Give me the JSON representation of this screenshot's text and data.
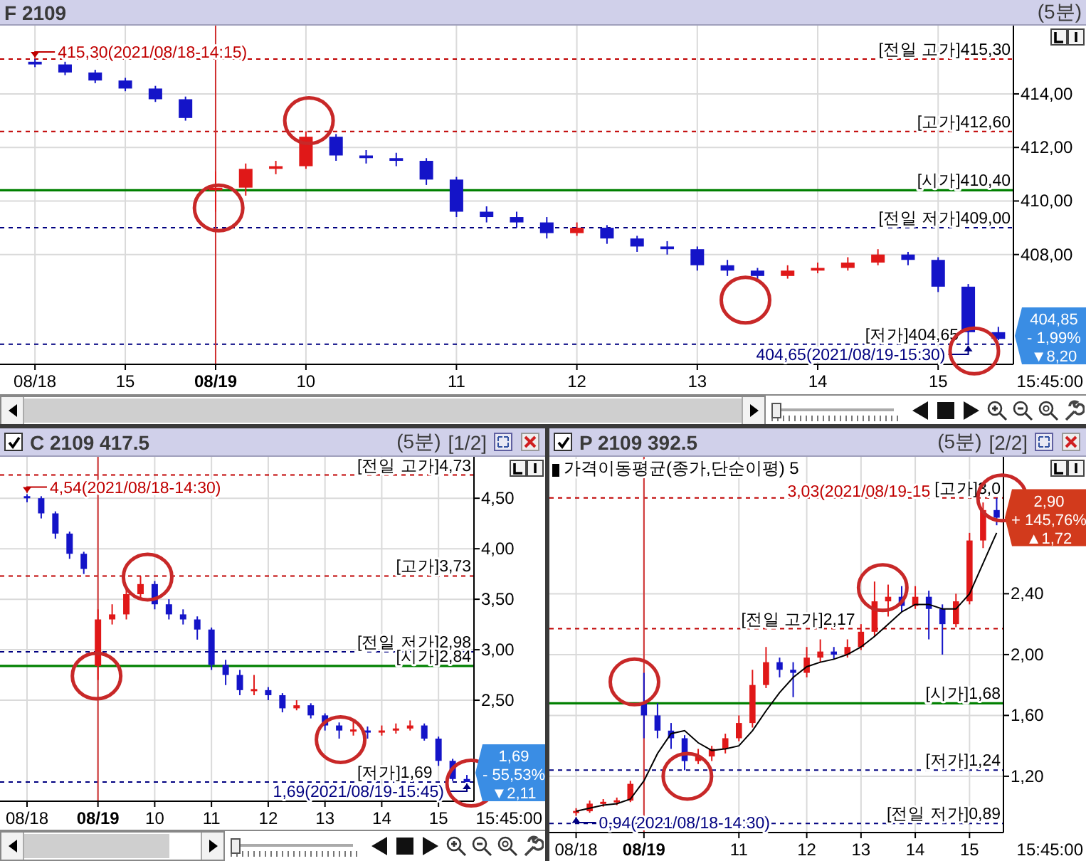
{
  "panels": [
    {
      "kind": "main",
      "title": "F 2109",
      "period": "(5분)",
      "time_label": "15:45:00",
      "toolbar": {
        "level": 0
      },
      "quote": {
        "rising": false,
        "price": "404,85",
        "rate": "- 1,99%",
        "change": "▼8,20"
      },
      "chart_data": {
        "type": "candlestick",
        "grid": true,
        "ylim": [
          403.9,
          416.55
        ],
        "x": [
          "08/18",
          null,
          null,
          "15",
          null,
          null,
          "08/19",
          null,
          null,
          "10",
          null,
          null,
          null,
          null,
          "11",
          null,
          null,
          null,
          "12",
          null,
          null,
          null,
          "13",
          null,
          null,
          null,
          "14",
          null,
          null,
          null,
          "15",
          null,
          null
        ],
        "yticks": [
          {
            "value": 414,
            "label": "414,00"
          },
          {
            "value": 412,
            "label": "412,00"
          },
          {
            "value": 410,
            "label": "410,00"
          },
          {
            "value": 408,
            "label": "408,00"
          }
        ],
        "ohlc": [
          [
            415.2,
            415.3,
            415.0,
            415.1
          ],
          [
            415.1,
            415.2,
            414.7,
            414.8
          ],
          [
            414.8,
            414.9,
            414.4,
            414.5
          ],
          [
            414.5,
            414.6,
            414.1,
            414.2
          ],
          [
            414.2,
            414.3,
            413.7,
            413.8
          ],
          [
            413.8,
            413.9,
            413.0,
            413.1
          ],
          [
            410.4,
            411.1,
            409.6,
            410.5
          ],
          [
            410.5,
            411.4,
            410.2,
            411.2
          ],
          [
            411.2,
            411.5,
            411.0,
            411.3
          ],
          [
            411.3,
            412.6,
            411.2,
            412.4
          ],
          [
            412.4,
            412.5,
            411.5,
            411.7
          ],
          [
            411.7,
            411.9,
            411.4,
            411.6
          ],
          [
            411.6,
            411.8,
            411.3,
            411.5
          ],
          [
            411.5,
            411.6,
            410.6,
            410.8
          ],
          [
            410.8,
            410.9,
            409.4,
            409.6
          ],
          [
            409.6,
            409.8,
            409.2,
            409.4
          ],
          [
            409.4,
            409.6,
            409.0,
            409.2
          ],
          [
            409.2,
            409.4,
            408.6,
            408.8
          ],
          [
            408.8,
            409.2,
            408.7,
            409.0
          ],
          [
            409.0,
            409.1,
            408.4,
            408.6
          ],
          [
            408.6,
            408.7,
            408.1,
            408.3
          ],
          [
            408.3,
            408.5,
            408.0,
            408.2
          ],
          [
            408.2,
            408.3,
            407.4,
            407.6
          ],
          [
            407.6,
            407.8,
            407.2,
            407.4
          ],
          [
            407.4,
            407.5,
            407.0,
            407.2
          ],
          [
            407.2,
            407.6,
            407.1,
            407.4
          ],
          [
            407.4,
            407.7,
            407.3,
            407.5
          ],
          [
            407.5,
            407.9,
            407.4,
            407.7
          ],
          [
            407.7,
            408.2,
            407.6,
            408.0
          ],
          [
            408.0,
            408.1,
            407.6,
            407.8
          ],
          [
            407.8,
            407.9,
            406.6,
            406.8
          ],
          [
            406.8,
            406.9,
            404.65,
            405.1
          ],
          [
            405.1,
            405.3,
            404.8,
            404.85
          ]
        ],
        "ref_lines": [
          {
            "axis": "y",
            "value": 415.3,
            "label": "[전일 고가]415,30",
            "color": "#c00000"
          },
          {
            "axis": "y",
            "value": 412.6,
            "label": "[고가]412,60",
            "color": "#c00000"
          },
          {
            "axis": "y",
            "value": 410.4,
            "label": "[시가]410,40",
            "color": "#008000"
          },
          {
            "axis": "y",
            "value": 409.0,
            "label": "[전일 저가]409,00",
            "color": "#000080"
          },
          {
            "axis": "y",
            "value": 404.65,
            "label": "[저가]404,65",
            "color": "#000080"
          }
        ],
        "annotations": [
          "415,30(2021/08/18-14:15)",
          "404,65(2021/08/19-15:30)"
        ]
      }
    },
    {
      "kind": "left",
      "checked": true,
      "title": "C 2109 417.5",
      "period": "(5분)",
      "page": "[1/2]",
      "closable": true,
      "time_label": "15:45:00",
      "toolbar": {
        "level": 0
      },
      "quote": {
        "rising": false,
        "price": "1,69",
        "rate": "- 55,53%",
        "change": "▼2,11"
      },
      "chart_data": {
        "type": "candlestick",
        "grid": true,
        "ylim": [
          1.5,
          4.91
        ],
        "x": [
          "08/18",
          null,
          null,
          null,
          null,
          "08/19",
          null,
          null,
          null,
          "10",
          null,
          null,
          null,
          "11",
          null,
          null,
          null,
          "12",
          null,
          null,
          null,
          "13",
          null,
          null,
          null,
          "14",
          null,
          null,
          null,
          "15",
          null,
          null
        ],
        "yticks": [
          {
            "value": 4.5,
            "label": "4,50"
          },
          {
            "value": 4.0,
            "label": "4,00"
          },
          {
            "value": 3.5,
            "label": "3,50"
          },
          {
            "value": 3.0,
            "label": "3,00"
          },
          {
            "value": 2.5,
            "label": "2,50"
          }
        ],
        "ohlc": [
          [
            4.52,
            4.54,
            4.46,
            4.5
          ],
          [
            4.5,
            4.52,
            4.3,
            4.35
          ],
          [
            4.35,
            4.37,
            4.1,
            4.15
          ],
          [
            4.15,
            4.17,
            3.9,
            3.95
          ],
          [
            3.95,
            3.97,
            3.75,
            3.8
          ],
          [
            2.84,
            3.4,
            2.7,
            3.3
          ],
          [
            3.3,
            3.45,
            3.25,
            3.35
          ],
          [
            3.35,
            3.6,
            3.3,
            3.55
          ],
          [
            3.55,
            3.73,
            3.5,
            3.65
          ],
          [
            3.65,
            3.68,
            3.4,
            3.45
          ],
          [
            3.45,
            3.5,
            3.3,
            3.35
          ],
          [
            3.35,
            3.4,
            3.25,
            3.3
          ],
          [
            3.3,
            3.33,
            3.1,
            3.2
          ],
          [
            3.2,
            3.22,
            2.8,
            2.85
          ],
          [
            2.85,
            2.9,
            2.65,
            2.75
          ],
          [
            2.75,
            2.8,
            2.55,
            2.6
          ],
          [
            2.6,
            2.75,
            2.55,
            2.6
          ],
          [
            2.6,
            2.63,
            2.5,
            2.55
          ],
          [
            2.55,
            2.57,
            2.38,
            2.42
          ],
          [
            2.42,
            2.5,
            2.4,
            2.45
          ],
          [
            2.45,
            2.47,
            2.32,
            2.35
          ],
          [
            2.35,
            2.37,
            2.2,
            2.25
          ],
          [
            2.25,
            2.28,
            2.12,
            2.2
          ],
          [
            2.2,
            2.3,
            2.15,
            2.2
          ],
          [
            2.2,
            2.24,
            2.12,
            2.18
          ],
          [
            2.18,
            2.25,
            2.15,
            2.2
          ],
          [
            2.2,
            2.27,
            2.17,
            2.22
          ],
          [
            2.22,
            2.3,
            2.2,
            2.25
          ],
          [
            2.25,
            2.27,
            2.1,
            2.12
          ],
          [
            2.12,
            2.14,
            1.85,
            1.9
          ],
          [
            1.9,
            1.92,
            1.7,
            1.72
          ],
          [
            1.72,
            1.76,
            1.69,
            1.69
          ]
        ],
        "ref_lines": [
          {
            "axis": "y",
            "value": 4.73,
            "label": "[전일 고가]4,73",
            "color": "#c00000"
          },
          {
            "axis": "y",
            "value": 3.73,
            "label": "[고가]3,73",
            "color": "#c00000"
          },
          {
            "axis": "y",
            "value": 2.98,
            "label": "[전일 저가]2,98",
            "color": "#000080"
          },
          {
            "axis": "y",
            "value": 2.84,
            "label": "[시가]2,84",
            "color": "#008000"
          },
          {
            "axis": "y",
            "value": 1.69,
            "label": "[저가]1,69",
            "color": "#000080"
          }
        ],
        "annotations": [
          "4,54(2021/08/18-14:30)",
          "1,69(2021/08/19-15:45)"
        ]
      }
    },
    {
      "kind": "right",
      "checked": true,
      "title": "P 2109 392.5",
      "period": "(5분)",
      "page": "[2/2]",
      "closable": true,
      "time_label": "15:45:00",
      "quote": {
        "rising": true,
        "price": "2,90",
        "rate": "+ 145,76%",
        "change": "▲1,72"
      },
      "chart_data": {
        "type": "candlestick",
        "grid": true,
        "ylim": [
          0.83,
          3.3
        ],
        "x": [
          "08/18",
          null,
          null,
          null,
          null,
          "08/19",
          null,
          null,
          null,
          null,
          null,
          null,
          "11",
          null,
          null,
          null,
          null,
          "12",
          null,
          null,
          null,
          "13",
          null,
          null,
          null,
          "14",
          null,
          null,
          null,
          "15",
          null,
          null
        ],
        "yticks": [
          {
            "value": 2.4,
            "label": "2,40"
          },
          {
            "value": 2.0,
            "label": "2,00"
          },
          {
            "value": 1.6,
            "label": "1,60"
          },
          {
            "value": 1.2,
            "label": "1,20"
          }
        ],
        "ohlc": [
          [
            0.96,
            0.99,
            0.94,
            0.97
          ],
          [
            0.97,
            1.04,
            0.96,
            1.02
          ],
          [
            1.02,
            1.05,
            1.0,
            1.03
          ],
          [
            1.03,
            1.06,
            1.01,
            1.04
          ],
          [
            1.04,
            1.17,
            1.03,
            1.15
          ],
          [
            1.68,
            1.88,
            1.45,
            1.6
          ],
          [
            1.6,
            1.68,
            1.45,
            1.5
          ],
          [
            1.5,
            1.55,
            1.38,
            1.45
          ],
          [
            1.45,
            1.47,
            1.24,
            1.3
          ],
          [
            1.3,
            1.38,
            1.28,
            1.33
          ],
          [
            1.33,
            1.4,
            1.3,
            1.38
          ],
          [
            1.38,
            1.48,
            1.35,
            1.45
          ],
          [
            1.45,
            1.6,
            1.43,
            1.55
          ],
          [
            1.55,
            1.9,
            1.52,
            1.8
          ],
          [
            1.8,
            2.05,
            1.78,
            1.95
          ],
          [
            1.95,
            1.98,
            1.85,
            1.9
          ],
          [
            1.9,
            1.95,
            1.72,
            1.88
          ],
          [
            1.88,
            2.05,
            1.85,
            1.98
          ],
          [
            1.98,
            2.1,
            1.95,
            2.02
          ],
          [
            2.02,
            2.05,
            1.97,
            2.0
          ],
          [
            2.0,
            2.1,
            1.98,
            2.05
          ],
          [
            2.05,
            2.2,
            2.03,
            2.15
          ],
          [
            2.15,
            2.48,
            2.12,
            2.35
          ],
          [
            2.35,
            2.46,
            2.25,
            2.38
          ],
          [
            2.38,
            2.45,
            2.28,
            2.32
          ],
          [
            2.32,
            2.45,
            2.3,
            2.38
          ],
          [
            2.38,
            2.42,
            2.1,
            2.3
          ],
          [
            2.3,
            2.33,
            2.0,
            2.2
          ],
          [
            2.2,
            2.4,
            2.18,
            2.35
          ],
          [
            2.35,
            2.8,
            2.33,
            2.75
          ],
          [
            2.75,
            3.0,
            2.7,
            2.95
          ],
          [
            2.95,
            3.03,
            2.85,
            2.9
          ]
        ],
        "series": [
          {
            "name": "가격이동평균(종가,단순이평) 5",
            "type": "line",
            "color": "#000000",
            "values": [
              0.97,
              0.99,
              1.01,
              1.02,
              1.05,
              1.17,
              1.35,
              1.48,
              1.5,
              1.42,
              1.37,
              1.38,
              1.4,
              1.5,
              1.63,
              1.75,
              1.85,
              1.92,
              1.95,
              1.97,
              2.0,
              2.05,
              2.12,
              2.2,
              2.28,
              2.33,
              2.33,
              2.3,
              2.3,
              2.4,
              2.6,
              2.8
            ]
          }
        ],
        "ref_lines": [
          {
            "axis": "y",
            "value": 3.03,
            "label": "[고가]3,0",
            "color": "#c00000"
          },
          {
            "axis": "y",
            "value": 2.17,
            "label": "[전일 고가]2,17",
            "color": "#c00000"
          },
          {
            "axis": "y",
            "value": 1.68,
            "label": "[시가]1,68",
            "color": "#008000"
          },
          {
            "axis": "y",
            "value": 1.24,
            "label": "[저가]1,24",
            "color": "#000080"
          },
          {
            "axis": "y",
            "value": 0.89,
            "label": "[전일 저가]0,89",
            "color": "#000080"
          }
        ],
        "annotations": [
          "3,03(2021/08/19-15",
          "0,94(2021/08/18-14:30)"
        ]
      }
    }
  ]
}
